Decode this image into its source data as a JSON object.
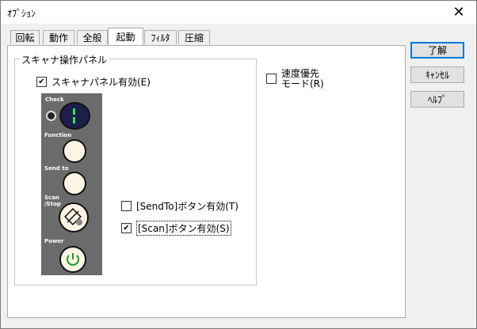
{
  "window": {
    "title": "ｵﾌﾟｼｮﾝ"
  },
  "tabs": [
    {
      "label": "回転",
      "active": false
    },
    {
      "label": "動作",
      "active": false
    },
    {
      "label": "全般",
      "active": false
    },
    {
      "label": "起動",
      "active": true
    },
    {
      "label": "ﾌｨﾙﾀ",
      "active": false
    },
    {
      "label": "圧縮",
      "active": false
    }
  ],
  "group": {
    "label": "スキャナ操作パネル"
  },
  "checkboxes": {
    "panel_enable": {
      "label": "スキャナパネル有効(E)",
      "checked": true
    },
    "speed_priority": {
      "label_line1": "速度優先",
      "label_line2": "モード(R)",
      "checked": false
    },
    "sendto_enable": {
      "label": "[SendTo]ボタン有効(T)",
      "checked": false
    },
    "scan_enable": {
      "label": "[Scan]ボタン有効(S)",
      "checked": true
    }
  },
  "panel_image": {
    "labels": {
      "check": "Check",
      "function": "Function",
      "send_to": "Send to",
      "scan_stop_line1": "Scan",
      "scan_stop_line2": "/Stop",
      "power": "Power"
    },
    "display_value": "1",
    "colors": {
      "panel": "#6b6b6b",
      "display_bg": "#1b1f4a",
      "display_digit": "#39e04a",
      "power_icon": "#1a9a2a"
    }
  },
  "buttons": {
    "ok": "了解",
    "cancel": "ｷｬﾝｾﾙ",
    "help": "ﾍﾙﾌﾟ"
  }
}
